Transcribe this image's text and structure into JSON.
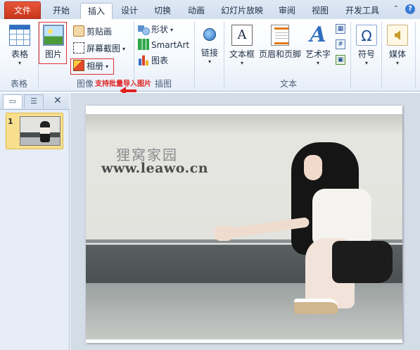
{
  "tabs": [
    {
      "label": "文件"
    },
    {
      "label": "开始"
    },
    {
      "label": "插入"
    },
    {
      "label": "设计"
    },
    {
      "label": "切换"
    },
    {
      "label": "动画"
    },
    {
      "label": "幻灯片放映"
    },
    {
      "label": "审阅"
    },
    {
      "label": "视图"
    },
    {
      "label": "开发工具"
    }
  ],
  "tabbar_icons": [
    "collapse-ribbon-icon",
    "help-icon"
  ],
  "ribbon": {
    "table_group": {
      "button": "表格",
      "label": "表格"
    },
    "image_group": {
      "label": "图像",
      "picture": "图片",
      "clipart": "剪贴画",
      "screenshot": "屏幕截图",
      "album": "相册"
    },
    "illustration_group": {
      "label": "插图",
      "shapes": "形状",
      "smartart": "SmartArt",
      "chart": "图表"
    },
    "links_group": {
      "link": "链接"
    },
    "text_group": {
      "label": "文本",
      "textbox": "文本框",
      "header_footer": "页眉和页脚",
      "wordart": "艺术字"
    },
    "symbols_group": {
      "symbol": "符号",
      "symbol_glyph": "Ω"
    },
    "media_group": {
      "media": "媒体"
    }
  },
  "annotation": "支持批量导入图片",
  "slide_pane": {
    "slide_number": "1"
  },
  "slide": {
    "watermark_cn": "狸窝家园",
    "watermark_url": "www.leawo.cn"
  },
  "colors": {
    "file_tab": "#d9452a",
    "annotation": "#e02020",
    "selected_thumb": "#f8df8e"
  }
}
